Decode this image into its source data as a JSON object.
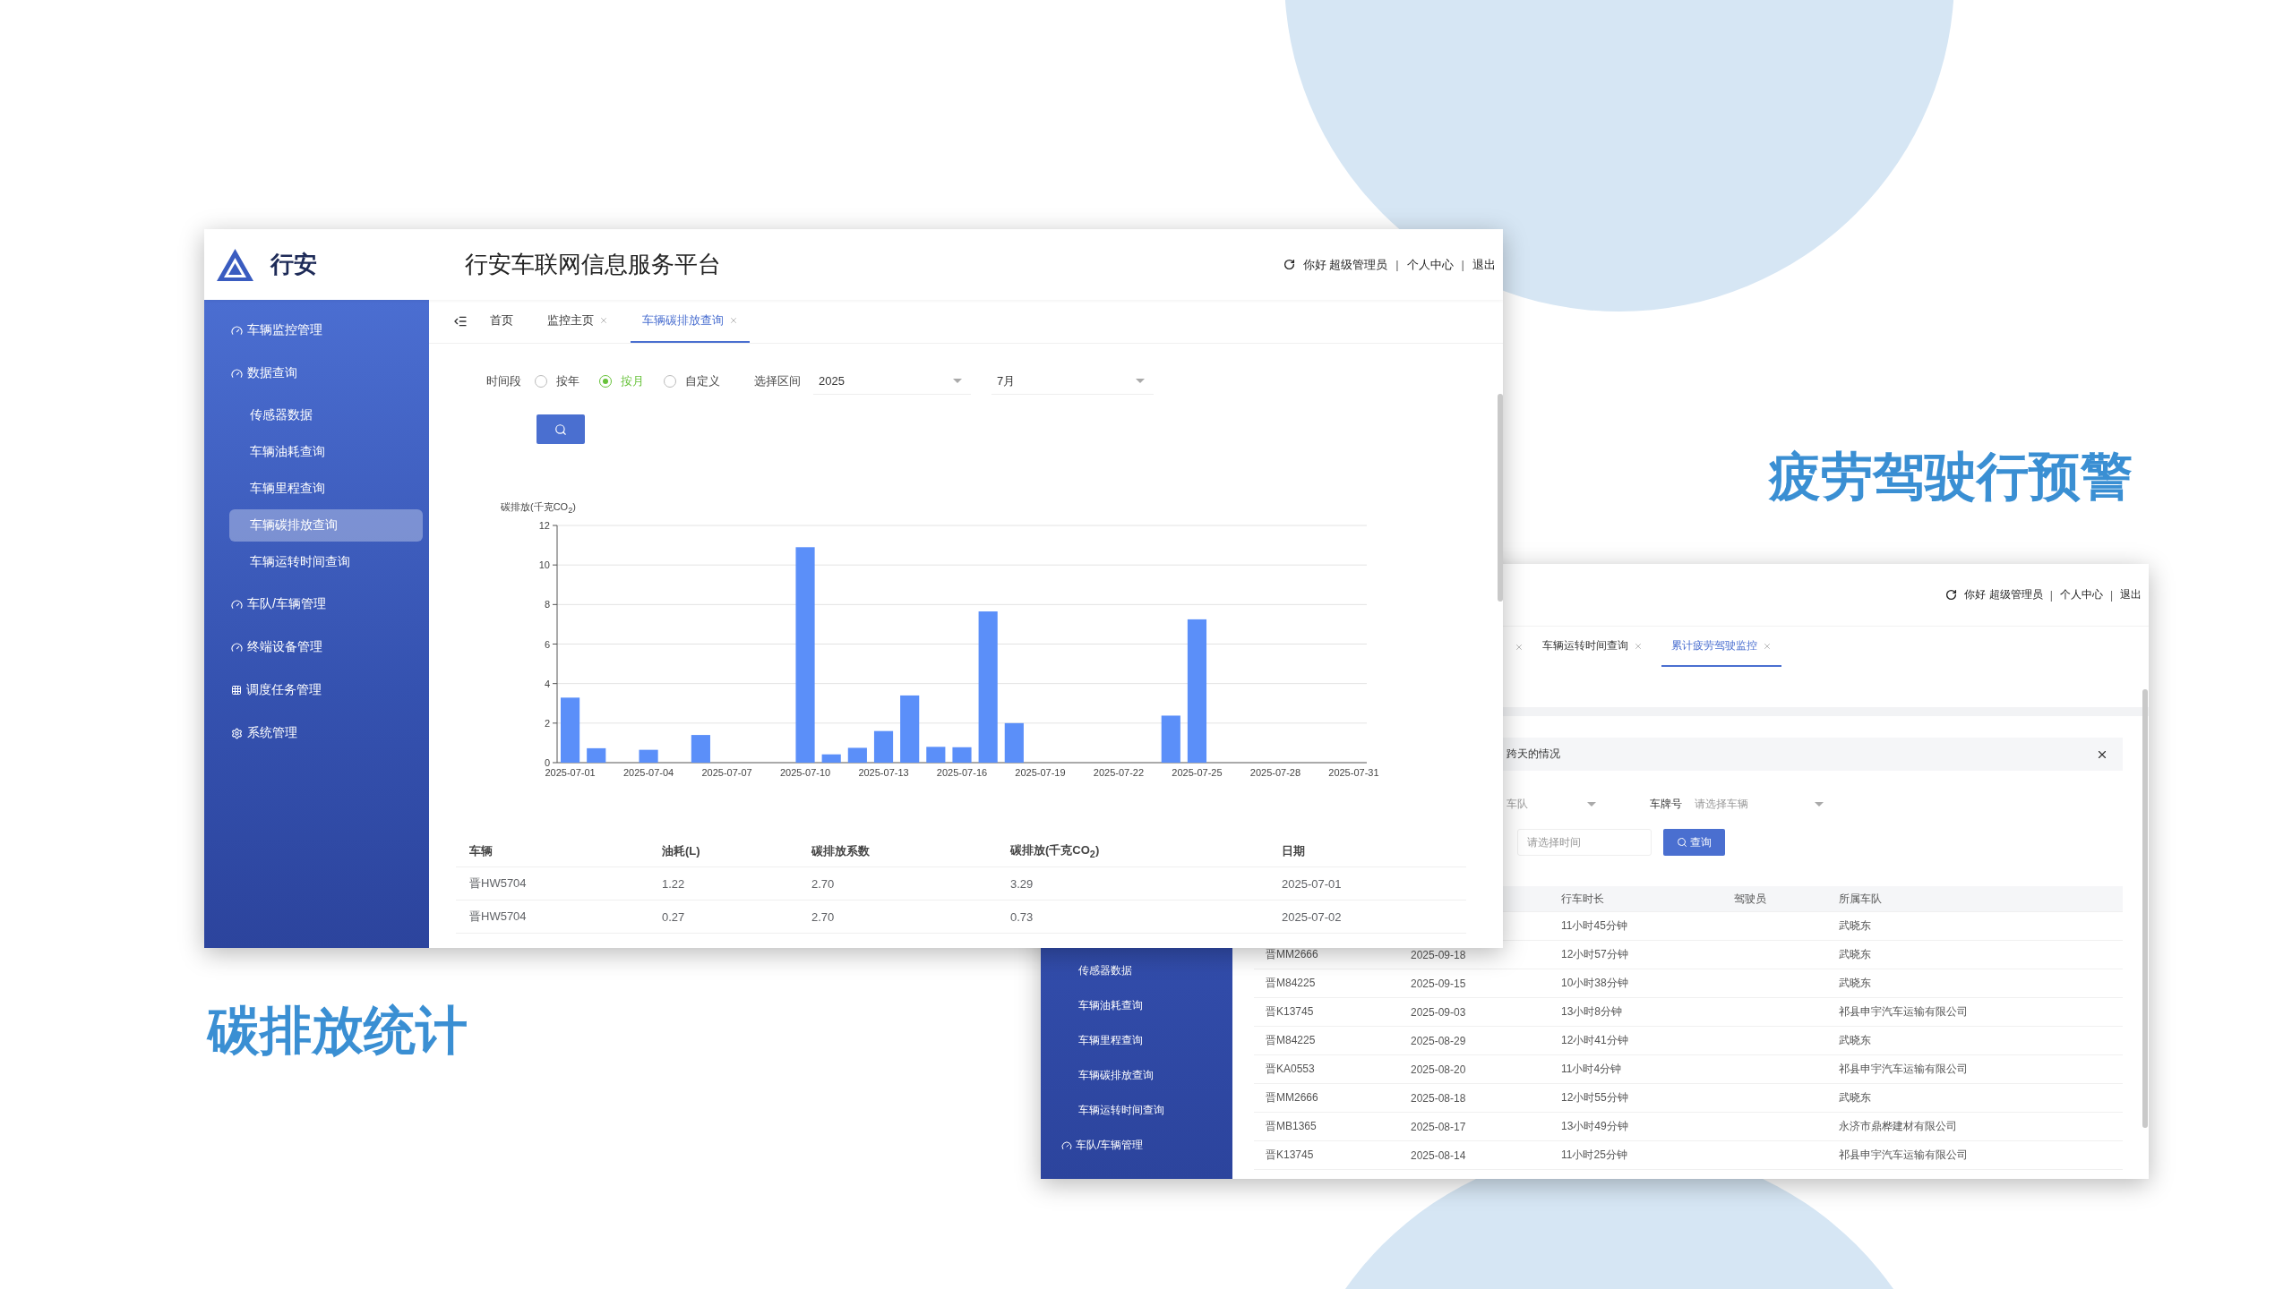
{
  "carbon_window": {
    "header": {
      "logo_text": "行安",
      "title": "行安车联网信息服务平台",
      "greeting": "你好 超级管理员",
      "links": [
        "个人中心",
        "退出"
      ],
      "separator": "|"
    },
    "sidebar": [
      {
        "label": "车辆监控管理",
        "kind": "gauge"
      },
      {
        "label": "数据查询",
        "kind": "gauge",
        "children": [
          {
            "label": "传感器数据",
            "selected": false
          },
          {
            "label": "车辆油耗查询",
            "selected": false
          },
          {
            "label": "车辆里程查询",
            "selected": false
          },
          {
            "label": "车辆碳排放查询",
            "selected": true
          },
          {
            "label": "车辆运转时间查询",
            "selected": false
          }
        ]
      },
      {
        "label": "车队/车辆管理",
        "kind": "gauge"
      },
      {
        "label": "终端设备管理",
        "kind": "gauge"
      },
      {
        "label": "调度任务管理",
        "kind": "grid"
      },
      {
        "label": "系统管理",
        "kind": "gear"
      }
    ],
    "tabs": [
      {
        "label": "首页",
        "closable": false,
        "selected": false
      },
      {
        "label": "监控主页",
        "closable": true,
        "selected": false
      },
      {
        "label": "车辆碳排放查询",
        "closable": true,
        "selected": true
      }
    ],
    "filter": {
      "period_label": "时间段",
      "periods": [
        {
          "label": "按年",
          "selected": false
        },
        {
          "label": "按月",
          "selected": true
        },
        {
          "label": "自定义",
          "selected": false
        }
      ],
      "range_label": "选择区间",
      "year": "2025",
      "month": "7月"
    },
    "chart_data": {
      "type": "bar",
      "ylabel": "碳排放(千克CO$_{2}$)",
      "ylim": [
        0,
        12
      ],
      "yticks": [
        0,
        2,
        4,
        6,
        8,
        10,
        12
      ],
      "grid": true,
      "categories": [
        "2025-07-01",
        null,
        null,
        "2025-07-04",
        null,
        null,
        "2025-07-07",
        null,
        null,
        "2025-07-10",
        null,
        null,
        "2025-07-13",
        null,
        null,
        "2025-07-16",
        null,
        null,
        "2025-07-19",
        null,
        null,
        "2025-07-22",
        null,
        null,
        "2025-07-25",
        null,
        null,
        "2025-07-28",
        null,
        null,
        "2025-07-31"
      ],
      "series": [
        {
          "color": "#5b8ff9",
          "values": [
            3.29,
            0.73,
            0,
            0.65,
            0,
            1.4,
            0,
            0,
            0,
            10.9,
            0.42,
            0.75,
            1.6,
            3.4,
            0.8,
            0.78,
            7.65,
            2.0,
            0,
            0,
            0,
            0,
            0,
            2.38,
            7.25,
            0,
            0,
            0,
            0,
            0,
            0
          ]
        }
      ]
    },
    "table": {
      "columns": [
        "车辆",
        "油耗(L)",
        "碳排放系数",
        "碳排放(千克CO$_{2}$)",
        "日期"
      ],
      "rows": [
        [
          "晋HW5704",
          "1.22",
          "2.70",
          "3.29",
          "2025-07-01"
        ],
        [
          "晋HW5704",
          "0.27",
          "2.70",
          "0.73",
          "2025-07-02"
        ]
      ]
    }
  },
  "fatigue_window": {
    "header": {
      "greeting": "你好 超级管理员",
      "links": [
        "个人中心",
        "退出"
      ],
      "separator": "|"
    },
    "sidebar": [
      {
        "label": "传感器数据",
        "kind": "sub"
      },
      {
        "label": "车辆油耗查询",
        "kind": "sub"
      },
      {
        "label": "车辆里程查询",
        "kind": "sub"
      },
      {
        "label": "车辆碳排放查询",
        "kind": "sub"
      },
      {
        "label": "车辆运转时间查询",
        "kind": "sub"
      },
      {
        "label": "车队/车辆管理",
        "kind": "group"
      }
    ],
    "tabs": [
      {
        "closable": true,
        "selected": false
      },
      {
        "label": "车辆运转时间查询",
        "closable": true,
        "selected": false
      },
      {
        "label": "累计疲劳驾驶监控",
        "closable": true,
        "selected": true
      }
    ],
    "alert": {
      "text": "跨天的情况"
    },
    "filters": {
      "team_placeholder": "车队",
      "plate_label": "车牌号",
      "plate_placeholder": "请选择车辆",
      "time_placeholder": "请选择时间",
      "query_button": "查询"
    },
    "table": {
      "columns": {
        "duration": "行车时长",
        "driver": "驾驶员",
        "team": "所属车队"
      },
      "rows": [
        {
          "duration": "11小时45分钟",
          "team": "武晓东"
        },
        {
          "plate": "晋MM2666",
          "date": "2025-09-18",
          "duration": "12小时57分钟",
          "team": "武晓东"
        },
        {
          "plate": "晋M84225",
          "date": "2025-09-15",
          "duration": "10小时38分钟",
          "team": "武晓东"
        },
        {
          "plate": "晋K13745",
          "date": "2025-09-03",
          "duration": "13小时8分钟",
          "team": "祁县申宇汽车运输有限公司"
        },
        {
          "plate": "晋M84225",
          "date": "2025-08-29",
          "duration": "12小时41分钟",
          "team": "武晓东"
        },
        {
          "plate": "晋KA0553",
          "date": "2025-08-20",
          "duration": "11小时4分钟",
          "team": "祁县申宇汽车运输有限公司"
        },
        {
          "plate": "晋MM2666",
          "date": "2025-08-18",
          "duration": "12小时55分钟",
          "team": "武晓东"
        },
        {
          "plate": "晋MB1365",
          "date": "2025-08-17",
          "duration": "13小时49分钟",
          "team": "永济市鼎桦建材有限公司"
        },
        {
          "plate": "晋K13745",
          "date": "2025-08-14",
          "duration": "11小时25分钟",
          "team": "祁县申宇汽车运输有限公司"
        }
      ]
    }
  },
  "captions": [
    "碳排放统计",
    "疲劳驾驶行预警"
  ]
}
